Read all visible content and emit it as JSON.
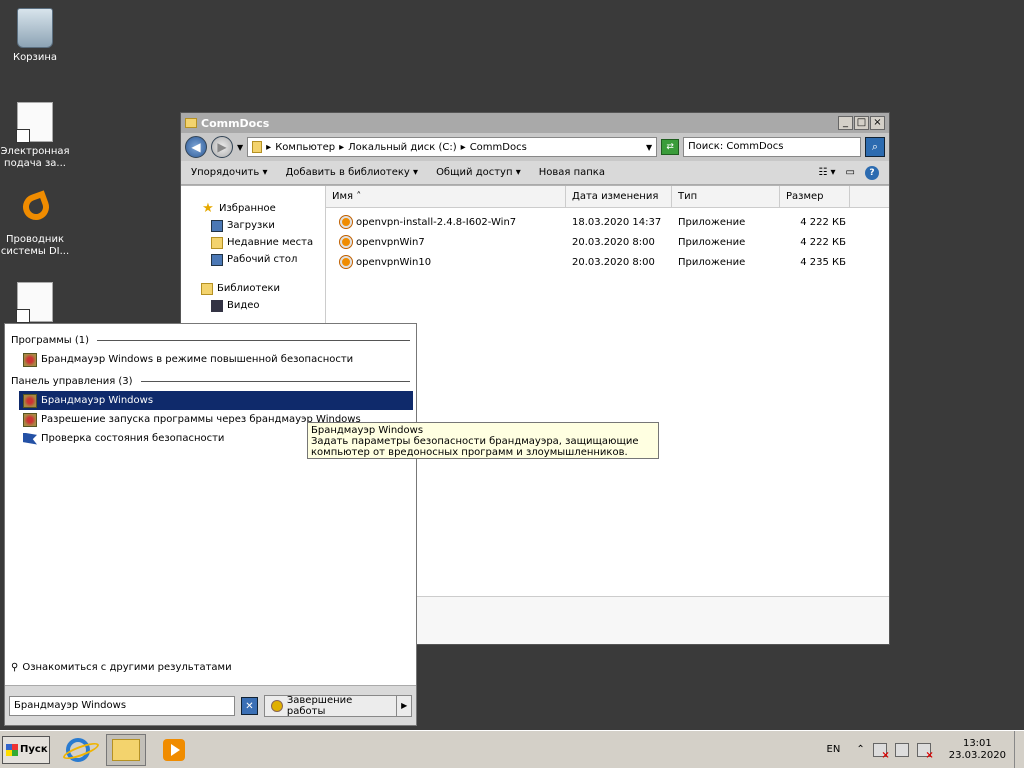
{
  "desktop": {
    "icons": [
      {
        "label": "Корзина"
      },
      {
        "label": "Электронная подача за..."
      },
      {
        "label": "Проводник системы DI..."
      }
    ]
  },
  "explorer": {
    "title": "CommDocs",
    "breadcrumb": [
      "Компьютер",
      "Локальный диск (C:)",
      "CommDocs"
    ],
    "search_placeholder": "Поиск: CommDocs",
    "toolbar": {
      "organize": "Упорядочить",
      "add_to_library": "Добавить в библиотеку",
      "share": "Общий доступ",
      "new_folder": "Новая папка"
    },
    "nav": {
      "favorites": "Избранное",
      "downloads": "Загрузки",
      "recent": "Недавние места",
      "desktop": "Рабочий стол",
      "libraries": "Библиотеки",
      "video": "Видео"
    },
    "columns": {
      "name": "Имя",
      "date": "Дата изменения",
      "type": "Тип",
      "size": "Размер"
    },
    "files": [
      {
        "name": "openvpn-install-2.4.8-I602-Win7",
        "date": "18.03.2020 14:37",
        "type": "Приложение",
        "size": "4 222 КБ"
      },
      {
        "name": "openvpnWin7",
        "date": "20.03.2020 8:00",
        "type": "Приложение",
        "size": "4 222 КБ"
      },
      {
        "name": "openvpnWin10",
        "date": "20.03.2020 8:00",
        "type": "Приложение",
        "size": "4 235 КБ"
      }
    ]
  },
  "startmenu": {
    "programs_header": "Программы (1)",
    "programs": [
      {
        "label": "Брандмауэр Windows в режиме повышенной безопасности"
      }
    ],
    "control_header": "Панель управления (3)",
    "control_items": [
      {
        "label": "Брандмауэр Windows"
      },
      {
        "label": "Разрешение запуска программы через брандмауэр Windows"
      },
      {
        "label": "Проверка состояния безопасности"
      }
    ],
    "more_results": "Ознакомиться с другими результатами",
    "search_value": "Брандмауэр Windows",
    "shutdown": "Завершение работы"
  },
  "tooltip": {
    "title": "Брандмауэр Windows",
    "text": "Задать параметры безопасности брандмауэра, защищающие компьютер от вредоносных программ и злоумышленников."
  },
  "taskbar": {
    "start": "Пуск",
    "lang": "EN",
    "time": "13:01",
    "date": "23.03.2020"
  }
}
